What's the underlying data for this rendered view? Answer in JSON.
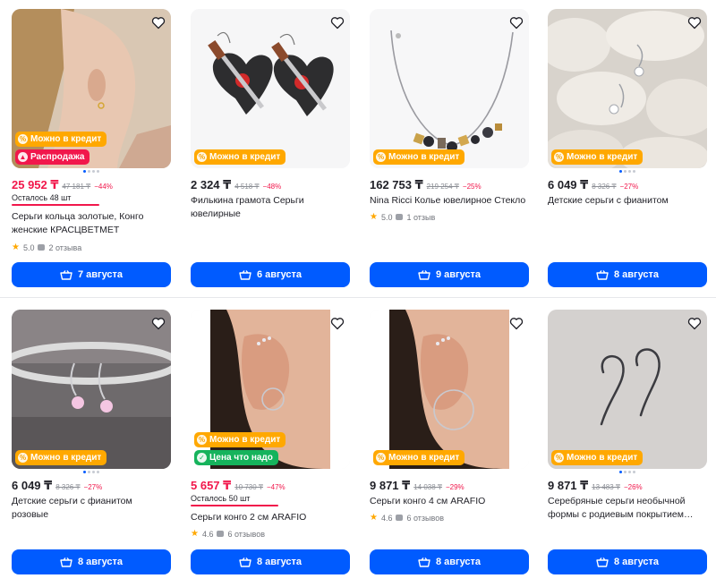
{
  "products": [
    {
      "price": "25 952 ₸",
      "old_price": "47 181 ₸",
      "discount": "−44%",
      "stock": "Осталось 48 шт",
      "title": "Серьги кольца золотые, Конго женские КРАСЦВЕТМЕТ",
      "rating": "5.0",
      "reviews": "2 отзыва",
      "badges": [
        "Можно в кредит",
        "Распродажа"
      ],
      "delivery": "7 августа"
    },
    {
      "price": "2 324 ₸",
      "old_price": "4 518 ₸",
      "discount": "−48%",
      "title": "Филькина грамота Серьги ювелирные",
      "badges": [
        "Можно в кредит"
      ],
      "delivery": "6 августа"
    },
    {
      "price": "162 753 ₸",
      "old_price": "219 254 ₸",
      "discount": "−25%",
      "title": "Nina Ricci Колье ювелирное Стекло",
      "rating": "5.0",
      "reviews": "1 отзыв",
      "badges": [
        "Можно в кредит"
      ],
      "delivery": "9 августа"
    },
    {
      "price": "6 049 ₸",
      "old_price": "8 326 ₸",
      "discount": "−27%",
      "title": "Детские серьги с фианитом",
      "badges": [
        "Можно в кредит"
      ],
      "delivery": "8 августа"
    },
    {
      "price": "6 049 ₸",
      "old_price": "8 326 ₸",
      "discount": "−27%",
      "title": "Детские серьги с фианитом розовые",
      "badges": [
        "Можно в кредит"
      ],
      "delivery": "8 августа"
    },
    {
      "price": "5 657 ₸",
      "old_price": "10 730 ₸",
      "discount": "−47%",
      "stock": "Осталось 50 шт",
      "title": "Серьги конго 2 см ARAFIO",
      "rating": "4.6",
      "reviews": "6 отзывов",
      "badges": [
        "Можно в кредит",
        "Цена что надо"
      ],
      "delivery": "8 августа"
    },
    {
      "price": "9 871 ₸",
      "old_price": "14 038 ₸",
      "discount": "−29%",
      "title": "Серьги конго 4 см ARAFIO",
      "rating": "4.6",
      "reviews": "6 отзывов",
      "badges": [
        "Можно в кредит"
      ],
      "delivery": "8 августа"
    },
    {
      "price": "9 871 ₸",
      "old_price": "13 483 ₸",
      "discount": "−26%",
      "title": "Серебряные серьги необычной формы с родиевым покрытием…",
      "badges": [
        "Можно в кредит"
      ],
      "delivery": "8 августа"
    }
  ],
  "colors": {
    "accent": "#005bff",
    "sale": "#f1174b",
    "credit": "#ffa800",
    "best_price": "#16b35c",
    "star": "#ffa800"
  },
  "icons": {
    "favorite": "heart-outline-icon",
    "cart": "basket-icon",
    "credit": "percent-icon",
    "sale": "flame-icon",
    "best_price": "thumbs-up-icon"
  }
}
